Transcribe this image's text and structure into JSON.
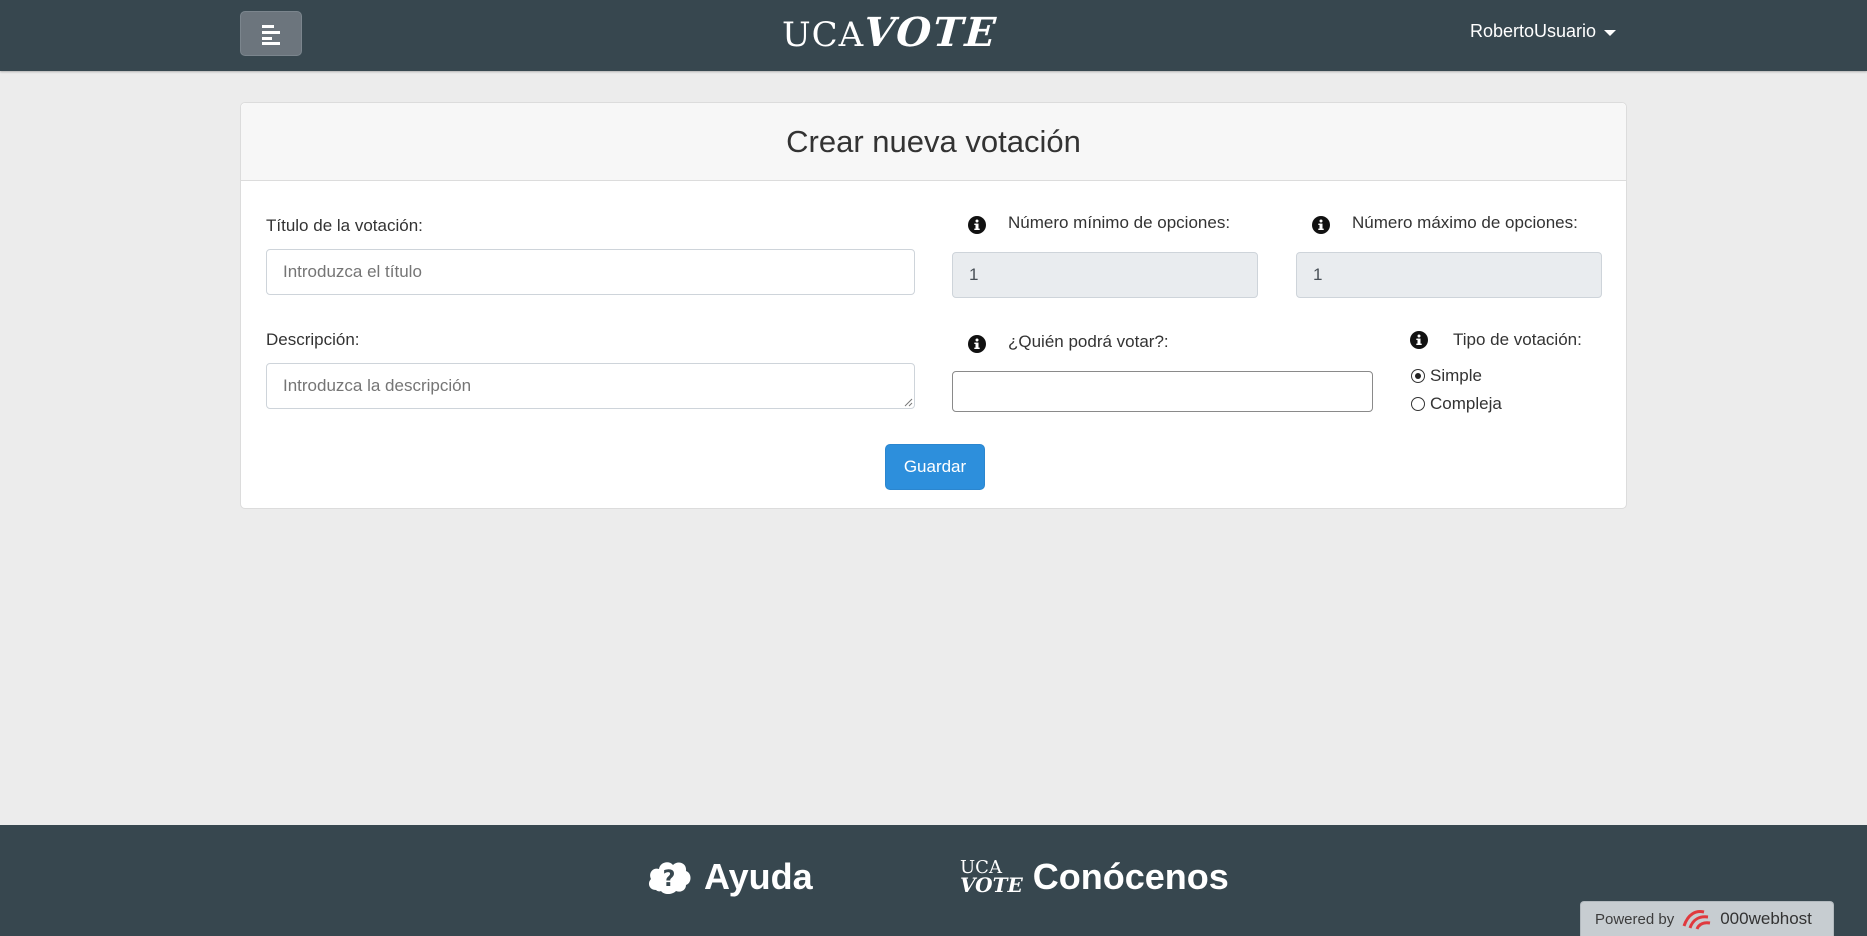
{
  "header": {
    "brand_uca": "UCA",
    "brand_vote": "VOTE",
    "username": "RobertoUsuario"
  },
  "form": {
    "title": "Crear nueva votación",
    "titulo_label": "Título de la votación:",
    "titulo_placeholder": "Introduzca el título",
    "descripcion_label": "Descripción:",
    "descripcion_placeholder": "Introduzca la descripción",
    "min_label": "Número mínimo de opciones:",
    "min_value": "1",
    "max_label": "Número máximo de opciones:",
    "max_value": "1",
    "quien_label": "¿Quién podrá votar?:",
    "quien_value": "",
    "tipo_label": "Tipo de votación:",
    "tipo_options": [
      "Simple",
      "Compleja"
    ],
    "tipo_selected": "Simple",
    "save_label": "Guardar"
  },
  "footer": {
    "ayuda_label": "Ayuda",
    "conocenos_label": "Conócenos",
    "mini_logo_uca": "UCA",
    "mini_logo_vote": "VOTE",
    "powered_by": "Powered by",
    "powered_brand": "000webhost"
  },
  "colors": {
    "header_bg": "#37474f",
    "page_bg": "#ececec",
    "primary_button": "#2d8fdc"
  }
}
